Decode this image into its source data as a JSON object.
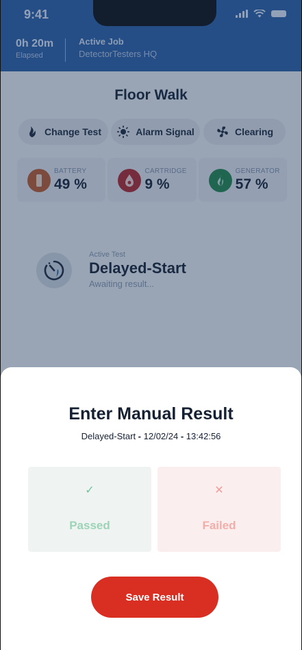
{
  "status_bar": {
    "time": "9:41"
  },
  "header": {
    "elapsed_value": "0h 20m",
    "elapsed_label": "Elapsed",
    "job_title": "Active Job",
    "job_name": "DetectorTesters HQ"
  },
  "page": {
    "title": "Floor Walk"
  },
  "chips": [
    {
      "label": "Change Test",
      "icon": "flame-icon"
    },
    {
      "label": "Alarm Signal",
      "icon": "sun-icon"
    },
    {
      "label": "Clearing",
      "icon": "fan-icon"
    }
  ],
  "stats": [
    {
      "label": "BATTERY",
      "value": "49 %",
      "color": "#c05a2c",
      "icon": "battery-icon"
    },
    {
      "label": "CARTRIDGE",
      "value": "9 %",
      "color": "#b4262c",
      "icon": "drop-icon"
    },
    {
      "label": "GENERATOR",
      "value": "57 %",
      "color": "#20874a",
      "icon": "flame-icon"
    }
  ],
  "active_test": {
    "label": "Active Test",
    "name": "Delayed-Start",
    "status": "Awaiting result..."
  },
  "sheet": {
    "title": "Enter Manual Result",
    "test_name": "Delayed-Start",
    "sep1": " - ",
    "date": "12/02/24",
    "sep2": " - ",
    "time": "13:42:56",
    "passed_label": "Passed",
    "failed_label": "Failed",
    "pass_icon": "✓",
    "fail_icon": "✕",
    "save_label": "Save Result"
  },
  "colors": {
    "header": "#2a5fa7",
    "accent": "#d92e22",
    "pass": "#6cc39a",
    "fail": "#f09d9a"
  }
}
